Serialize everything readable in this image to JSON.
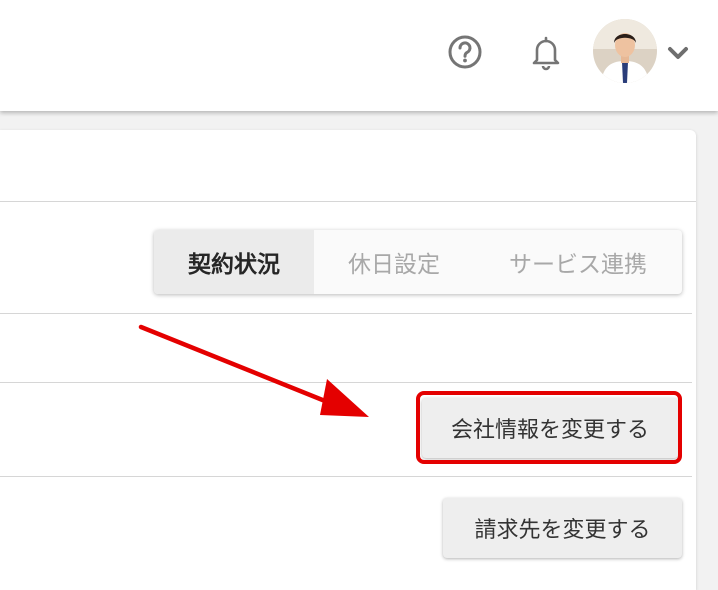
{
  "header": {
    "help_icon": "question-circle-icon",
    "bell_icon": "bell-icon",
    "avatar_label": "user avatar",
    "menu_icon": "chevron-down-icon"
  },
  "tabs": [
    {
      "label": "契約状況",
      "active": true
    },
    {
      "label": "休日設定",
      "active": false
    },
    {
      "label": "サービス連携",
      "active": false
    }
  ],
  "buttons": {
    "company": "会社情報を変更する",
    "billing": "請求先を変更する"
  },
  "annotation": {
    "color": "#e40000"
  }
}
